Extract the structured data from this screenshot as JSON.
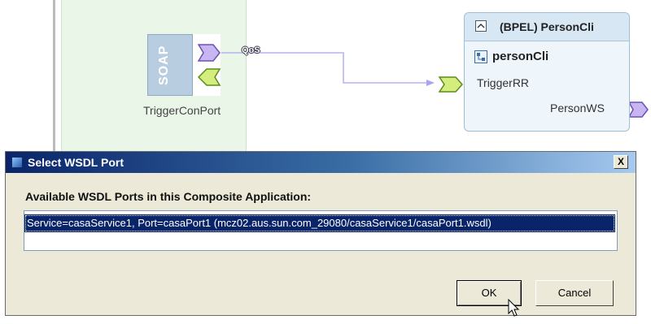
{
  "editor": {
    "soap_label": "SOAP",
    "soap_port_caption": "TriggerConPort",
    "qos_label": "QoS",
    "bpel_module": {
      "title": "(BPEL) PersonCli",
      "node_name": "personCli",
      "consume_endpoint": "TriggerRR",
      "provide_endpoint": "PersonWS"
    },
    "icons": [
      "collapse-icon",
      "bpel-process-icon",
      "consume-arrow-icon",
      "provide-arrow-icon"
    ],
    "colors": {
      "soap_strip": "#b9cde0",
      "region": "#eaf6e8",
      "bpel_header": "#d7e7f4",
      "provide_arrow": "#c7b6f2",
      "consume_arrow": "#d3ee7c"
    }
  },
  "dialog": {
    "title": "Select WSDL Port",
    "close_label": "X",
    "heading": "Available WSDL Ports in this Composite Application:",
    "ports": [
      "Service=casaService1, Port=casaPort1 (mcz02.aus.sun.com_29080/casaService1/casaPort1.wsdl)"
    ],
    "selected_index": 0,
    "ok_label": "OK",
    "cancel_label": "Cancel"
  }
}
